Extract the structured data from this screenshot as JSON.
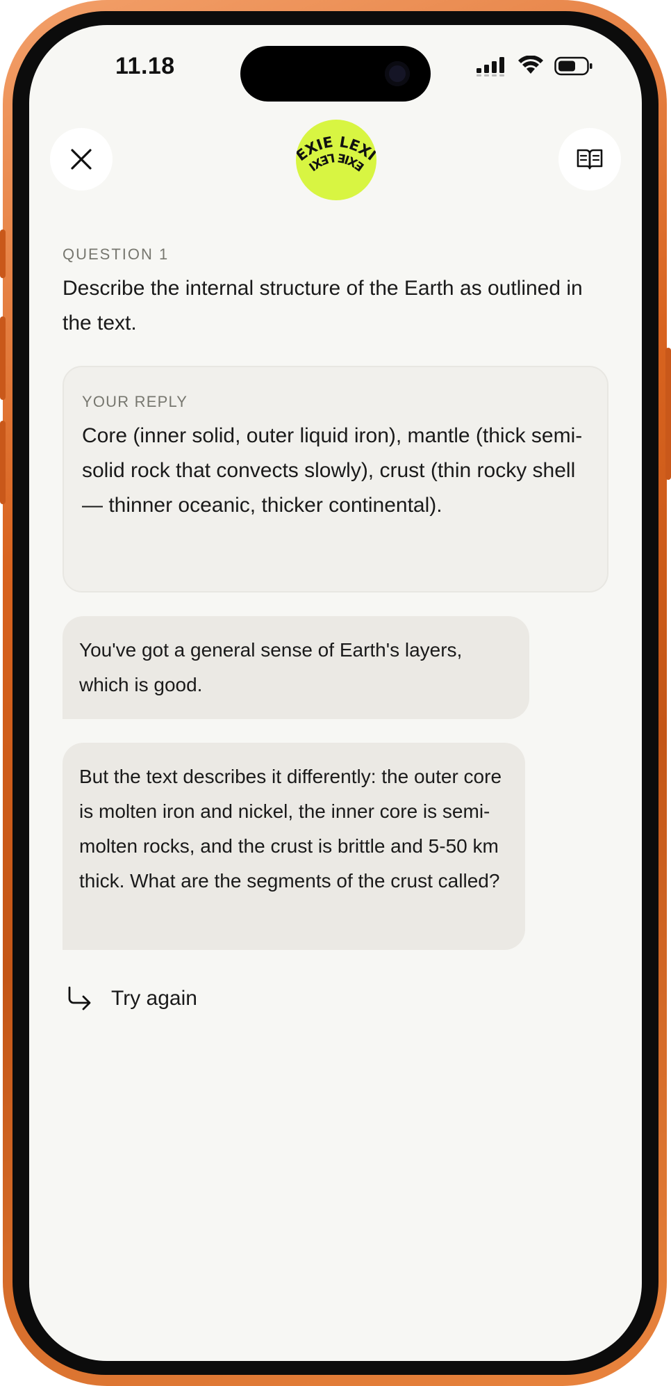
{
  "status_bar": {
    "time": "11.18"
  },
  "header": {
    "logo_text_top": "LEXIE LEXIE",
    "logo_text_bottom": "LEXIE LEXIE",
    "logo_color": "#d8f542"
  },
  "question": {
    "label": "QUESTION 1",
    "text": "Describe the internal structure of the Earth as outlined in the text."
  },
  "reply": {
    "label": "YOUR REPLY",
    "text": "Core (inner solid, outer liquid iron), mantle (thick semi-solid rock that convects slowly), crust (thin rocky shell — thinner oceanic, thicker continental)."
  },
  "feedback": [
    {
      "text": "You've got a general sense of Earth's layers, which is good."
    },
    {
      "text": "But the text describes it differently: the outer core is molten iron and nickel, the inner core is semi-molten rocks, and the crust is brittle and 5-50 km thick. What are the segments of the crust called?"
    }
  ],
  "actions": {
    "try_again_label": "Try again"
  },
  "colors": {
    "frame_accent": "#d8631f",
    "screen_bg": "#f7f7f4",
    "bubble_bg": "#ebe9e4"
  },
  "icons": {
    "close": "close-icon",
    "book": "book-icon",
    "try_again": "return-arrow-icon",
    "signal": "signal-icon",
    "wifi": "wifi-icon",
    "battery": "battery-icon"
  }
}
